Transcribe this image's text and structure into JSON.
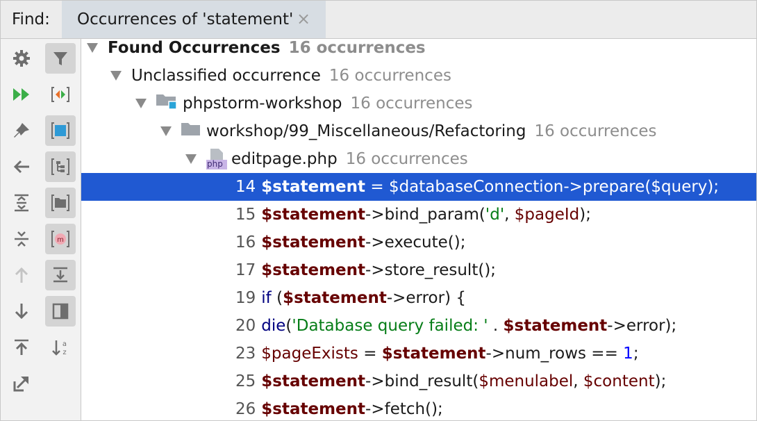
{
  "header": {
    "find_label": "Find:",
    "tab_title": "Occurrences of 'statement'",
    "tab_close": "×"
  },
  "toolbar": {
    "left": [
      "settings-icon",
      "rerun-icon",
      "pin-icon",
      "back-arrow-icon",
      "expand-all-icon",
      "collapse-all-icon",
      "previous-occurrence-icon",
      "next-occurrence-icon",
      "export-icon",
      "open-in-window-icon"
    ],
    "right": [
      "filter-icon",
      "merge-icon",
      "group-by-module-icon",
      "group-by-package-icon",
      "group-by-directory-icon",
      "group-by-method-icon",
      "autoscroll-icon",
      "preview-icon",
      "sort-alphabetically-icon"
    ]
  },
  "tree": {
    "root_label": "Found Occurrences",
    "root_count": "16 occurrences",
    "group_label": "Unclassified occurrence",
    "group_count": "16 occurrences",
    "project_label": "phpstorm-workshop",
    "project_count": "16 occurrences",
    "dir_label": "workshop/99_Miscellaneous/Refactoring",
    "dir_count": "16 occurrences",
    "file_label": "editpage.php",
    "file_icon_text": "php",
    "file_count": "16 occurrences"
  },
  "results": [
    {
      "line": "14",
      "parts": [
        [
          "varb",
          "$statement"
        ],
        [
          "plain",
          " = "
        ],
        [
          "var",
          "$databaseConnection"
        ],
        [
          "plain",
          "->prepare("
        ],
        [
          "var",
          "$query"
        ],
        [
          "plain",
          ");"
        ]
      ]
    },
    {
      "line": "15",
      "parts": [
        [
          "varb",
          "$statement"
        ],
        [
          "plain",
          "->bind_param("
        ],
        [
          "str",
          "'d'"
        ],
        [
          "plain",
          ", "
        ],
        [
          "var",
          "$pageId"
        ],
        [
          "plain",
          ");"
        ]
      ]
    },
    {
      "line": "16",
      "parts": [
        [
          "varb",
          "$statement"
        ],
        [
          "plain",
          "->execute();"
        ]
      ]
    },
    {
      "line": "17",
      "parts": [
        [
          "varb",
          "$statement"
        ],
        [
          "plain",
          "->store_result();"
        ]
      ]
    },
    {
      "line": "19",
      "parts": [
        [
          "kw",
          "if"
        ],
        [
          "plain",
          " ("
        ],
        [
          "varb",
          "$statement"
        ],
        [
          "plain",
          "->error) {"
        ]
      ]
    },
    {
      "line": "20",
      "parts": [
        [
          "kw",
          "die"
        ],
        [
          "plain",
          "("
        ],
        [
          "str",
          "'Database query failed: '"
        ],
        [
          "plain",
          " . "
        ],
        [
          "varb",
          "$statement"
        ],
        [
          "plain",
          "->error);"
        ]
      ]
    },
    {
      "line": "23",
      "parts": [
        [
          "var",
          "$pageExists"
        ],
        [
          "plain",
          " = "
        ],
        [
          "varb",
          "$statement"
        ],
        [
          "plain",
          "->num_rows == "
        ],
        [
          "num",
          "1"
        ],
        [
          "plain",
          ";"
        ]
      ]
    },
    {
      "line": "25",
      "parts": [
        [
          "varb",
          "$statement"
        ],
        [
          "plain",
          "->bind_result("
        ],
        [
          "var",
          "$menulabel"
        ],
        [
          "plain",
          ", "
        ],
        [
          "var",
          "$content"
        ],
        [
          "plain",
          ");"
        ]
      ]
    },
    {
      "line": "26",
      "parts": [
        [
          "varb",
          "$statement"
        ],
        [
          "plain",
          "->fetch();"
        ]
      ]
    }
  ],
  "colors": {
    "selection": "#2059d2",
    "variable": "#660000",
    "string": "#067d17",
    "keyword": "#000080",
    "number": "#0000ff"
  }
}
